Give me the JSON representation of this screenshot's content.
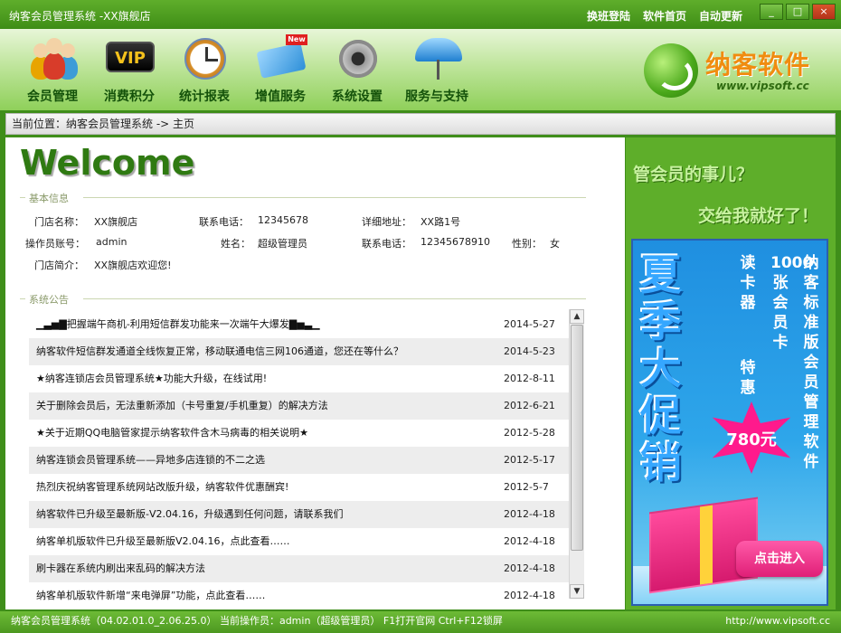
{
  "window": {
    "title": "纳客会员管理系统 -XX旗舰店",
    "links": [
      "换班登陆",
      "软件首页",
      "自动更新"
    ],
    "controls": [
      "_",
      "□",
      "×"
    ]
  },
  "toolbar": {
    "items": [
      {
        "label": "会员管理",
        "icon": "members-icon"
      },
      {
        "label": "消费积分",
        "icon": "vip-icon"
      },
      {
        "label": "统计报表",
        "icon": "clock-icon"
      },
      {
        "label": "增值服务",
        "icon": "card-icon"
      },
      {
        "label": "系统设置",
        "icon": "gear-icon"
      },
      {
        "label": "服务与支持",
        "icon": "umbrella-icon"
      }
    ],
    "new_badge": "New",
    "vip_text": "VIP"
  },
  "logo": {
    "name": "纳客软件",
    "url": "www.vipsoft.cc"
  },
  "breadcrumb": "当前位置：纳客会员管理系统 -> 主页",
  "welcome": "Welcome",
  "basic_info": {
    "title": "基本信息",
    "store_name_label": "门店名称：",
    "store_name": "XX旗舰店",
    "phone_label": "联系电话：",
    "phone": "12345678",
    "address_label": "详细地址：",
    "address": "XX路1号",
    "operator_label": "操作员账号：",
    "operator": "admin",
    "name_label": "姓名：",
    "name": "超级管理员",
    "phone2_label": "联系电话：",
    "phone2": "12345678910",
    "gender_label": "性别：",
    "gender": "女",
    "intro_label": "门店简介：",
    "intro": "XX旗舰店欢迎您!"
  },
  "notices": {
    "title": "系统公告",
    "items": [
      {
        "text": "▁▃▅▇把握端午商机-利用短信群发功能来一次端午大爆发▇▅▃▁",
        "date": "2014-5-27"
      },
      {
        "text": "纳客软件短信群发通道全线恢复正常，移动联通电信三网106通道，您还在等什么？",
        "date": "2014-5-23"
      },
      {
        "text": "★纳客连锁店会员管理系统★功能大升级，在线试用!",
        "date": "2012-8-11"
      },
      {
        "text": "关于删除会员后，无法重新添加（卡号重复/手机重复）的解决方法",
        "date": "2012-6-21"
      },
      {
        "text": "★关于近期QQ电脑管家提示纳客软件含木马病毒的相关说明★",
        "date": "2012-5-28"
      },
      {
        "text": "纳客连锁会员管理系统——异地多店连锁的不二之选",
        "date": "2012-5-17"
      },
      {
        "text": "热烈庆祝纳客管理系统网站改版升级，纳客软件优惠酬宾!",
        "date": "2012-5-7"
      },
      {
        "text": "纳客软件已升级至最新版-V2.04.16，升级遇到任何问题，请联系我们",
        "date": "2012-4-18"
      },
      {
        "text": "纳客单机版软件已升级至最新版V2.04.16，点此查看……",
        "date": "2012-4-18"
      },
      {
        "text": "刷卡器在系统内刷出来乱码的解决方法",
        "date": "2012-4-18"
      },
      {
        "text": "纳客单机版软件新增“来电弹屏”功能，点此查看……",
        "date": "2012-4-18"
      }
    ]
  },
  "ad": {
    "slogan1": "管会员的事儿？",
    "slogan2": "交给我就好了！",
    "headline": "夏季大促销",
    "col1": "纳客标准版会员管理软件",
    "col2": "1000张会员卡",
    "col3": "读卡器",
    "col4": "特惠",
    "price": "780元",
    "enter": "点击进入"
  },
  "status": {
    "left": "纳客会员管理系统（04.02.01.0_2.06.25.0） 当前操作员：admin（超级管理员） F1打开官网 Ctrl+F12锁屏",
    "right": "http://www.vipsoft.cc"
  },
  "colors": {
    "brand_green": "#3e8d16",
    "accent_orange": "#f08c10",
    "welcome_green": "#2f7a12"
  }
}
